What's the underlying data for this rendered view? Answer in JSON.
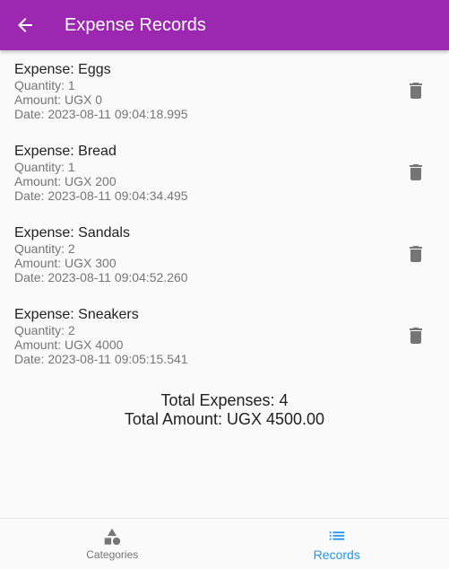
{
  "appbar": {
    "title": "Expense Records",
    "back_icon": "arrow-back-icon",
    "background": "#9c27b0"
  },
  "records": [
    {
      "title": "Expense: Eggs",
      "quantity": "Quantity: 1",
      "amount": "Amount: UGX 0",
      "date": "Date: 2023-08-11 09:04:18.995"
    },
    {
      "title": "Expense: Bread",
      "quantity": "Quantity: 1",
      "amount": "Amount: UGX 200",
      "date": "Date: 2023-08-11 09:04:34.495"
    },
    {
      "title": "Expense: Sandals",
      "quantity": "Quantity: 2",
      "amount": "Amount: UGX 300",
      "date": "Date: 2023-08-11 09:04:52.260"
    },
    {
      "title": "Expense: Sneakers",
      "quantity": "Quantity: 2",
      "amount": "Amount: UGX 4000",
      "date": "Date: 2023-08-11 09:05:15.541"
    }
  ],
  "record_action_icon": "delete-icon",
  "totals": {
    "expenses": "Total Expenses: 4",
    "amount": "Total Amount: UGX 4500.00"
  },
  "bottom_nav": {
    "items": [
      {
        "label": "Categories",
        "icon": "shapes-icon",
        "active": false
      },
      {
        "label": "Records",
        "icon": "list-icon",
        "active": true
      }
    ],
    "active_color": "#2196f3"
  }
}
